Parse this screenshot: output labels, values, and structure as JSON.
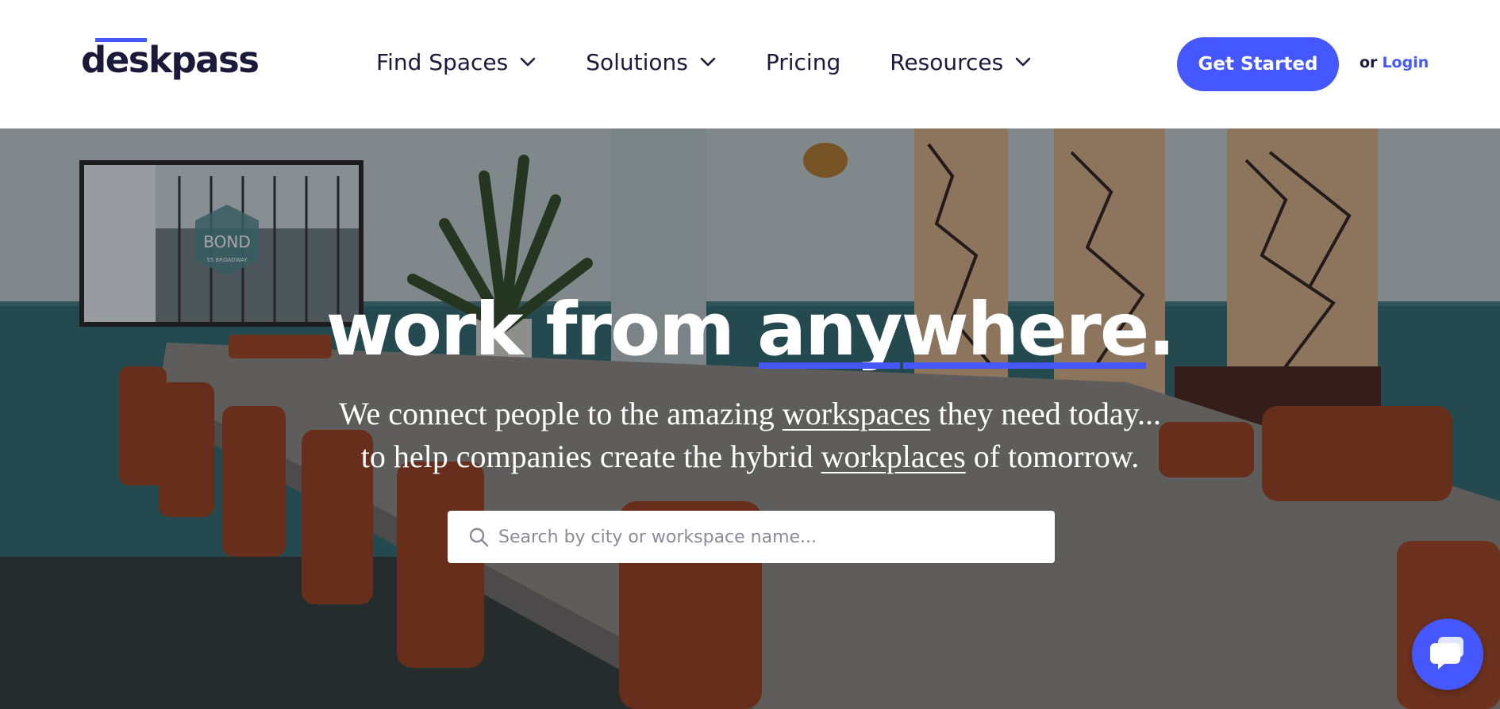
{
  "brand": {
    "name": "deskpass",
    "accent_color": "#4558ff",
    "dark_color": "#1c1a3b"
  },
  "nav": {
    "items": [
      {
        "label": "Find Spaces",
        "has_dropdown": true
      },
      {
        "label": "Solutions",
        "has_dropdown": true
      },
      {
        "label": "Pricing",
        "has_dropdown": false
      },
      {
        "label": "Resources",
        "has_dropdown": true
      }
    ]
  },
  "header": {
    "cta_label": "Get Started",
    "login_prefix": "or",
    "login_label": "Login"
  },
  "hero": {
    "headline_part1": "work from ",
    "headline_em1": "any",
    "headline_em2": "where",
    "headline_end": ".",
    "subline1_before": "We connect people to the amazing ",
    "subline1_link": "workspaces",
    "subline1_after": " they need today...",
    "subline2_before": "to help companies create the hybrid ",
    "subline2_link": "workplaces",
    "subline2_after": " of tomorrow.",
    "tv_sign_text": "BOND",
    "tv_sign_subtext": "55 BROADWAY"
  },
  "search": {
    "placeholder": "Search by city or workspace name...",
    "value": "",
    "icon": "search-icon"
  },
  "chat": {
    "icon": "chat-icon"
  }
}
